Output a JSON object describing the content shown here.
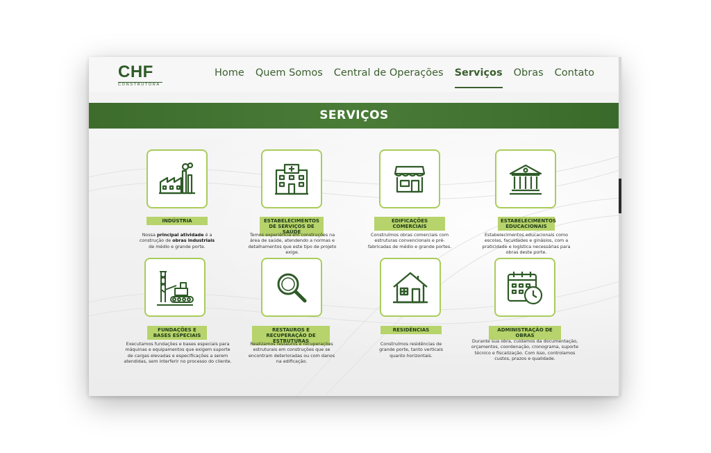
{
  "logo": {
    "name": "CHF",
    "sub": "CONSTRUTORA"
  },
  "nav": [
    {
      "label": "Home",
      "active": false
    },
    {
      "label": "Quem Somos",
      "active": false
    },
    {
      "label": "Central de Operações",
      "active": false
    },
    {
      "label": "Serviços",
      "active": true
    },
    {
      "label": "Obras",
      "active": false
    },
    {
      "label": "Contato",
      "active": false
    }
  ],
  "section_title": "SERVIÇOS",
  "services": [
    {
      "icon": "factory-icon",
      "title": "INDÚSTRIA",
      "desc_parts": [
        "Nossa ",
        "principal atividade",
        " é a construção de ",
        "obras industriais",
        " de médio e grande porte."
      ]
    },
    {
      "icon": "hospital-icon",
      "title": "ESTABELECIMENTOS DE SERVIÇOS DE SAÚDE",
      "desc": "Temos experiência em construções na área de saúde, atendendo a normas e detalhamentos que este tipo de projeto exige."
    },
    {
      "icon": "store-icon",
      "title": "EDIFICAÇÕES COMERCIAIS",
      "desc": "Construímos obras comerciais com estruturas convencionais e pré-fabricadas de médio e grande portes."
    },
    {
      "icon": "school-icon",
      "title": "ESTABELECIMENTOS EDUCACIONAIS",
      "desc": "Estabelecimentos educacionais como escolas, faculdades e ginásios, com a praticidade e logística necessárias para obras deste porte."
    },
    {
      "icon": "pile-driver-icon",
      "title": "FUNDAÇÕES E BASES ESPECIAIS",
      "desc": "Executamos fundações e bases especiais para máquinas e equipamentos que exigem suporte de cargas elevadas e especificações a serem atendidas, sem interferir no processo do cliente."
    },
    {
      "icon": "magnifier-icon",
      "title": "RESTAUROS E RECUPERAÇÃO DE ESTRUTURAS",
      "desc": "Realizamos restauros e recuperações estruturais em construções que se encontram deterioradas ou com danos na edificação."
    },
    {
      "icon": "house-icon",
      "title": "RESIDÊNCIAS",
      "desc": "Construímos residências de grande porte, tanto verticais quanto horizontais."
    },
    {
      "icon": "calendar-clock-icon",
      "title": "ADMINISTRAÇÃO DE OBRAS",
      "desc": "Durante sua obra, cuidamos da documentação, orçamentos, coordenação, cronograma, suporte técnico e fiscalização. Com isso, controlamos custos, prazos e qualidade."
    }
  ],
  "colors": {
    "brand": "#3b5f2f",
    "band": "#4a7c38",
    "accent": "#b7d36b",
    "border": "#a9cc5a"
  }
}
